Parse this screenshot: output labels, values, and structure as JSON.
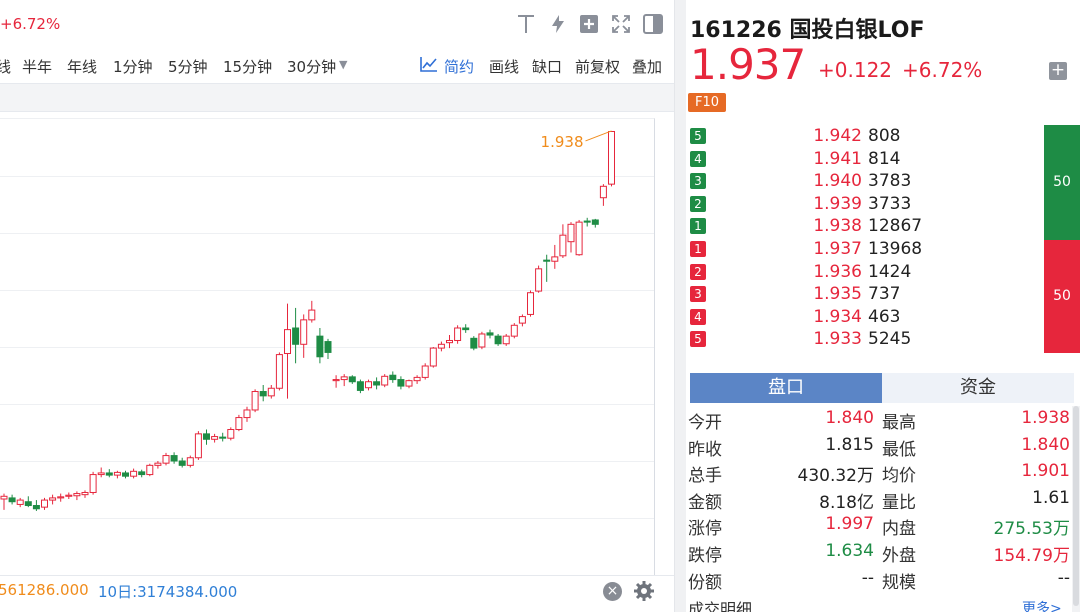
{
  "header_left": {
    "change_pct": "+6.72%"
  },
  "toolbar_icons": [
    "text-tool-icon",
    "lightning-icon",
    "add-box-icon",
    "fullscreen-icon",
    "panel-toggle-icon"
  ],
  "period_tabs": [
    {
      "label": "线"
    },
    {
      "label": "半年"
    },
    {
      "label": "年线"
    },
    {
      "label": "1分钟"
    },
    {
      "label": "5分钟"
    },
    {
      "label": "15分钟"
    },
    {
      "label": "30分钟"
    }
  ],
  "chart_tools": {
    "simple_label": "简约",
    "draw_label": "画线",
    "gap_label": "缺口",
    "adjust_label": "前复权",
    "overlay_label": "叠加"
  },
  "chart_data": {
    "type": "candlestick",
    "annotation": "1.938",
    "colors": {
      "up": "#e6263c",
      "down": "#1e8c45",
      "annotation": "#f08c1c"
    },
    "y_range": [
      1.12,
      1.96
    ],
    "candles": [
      [
        1.26,
        1.27,
        1.24,
        1.265
      ],
      [
        1.262,
        1.268,
        1.25,
        1.255
      ],
      [
        1.25,
        1.262,
        1.245,
        1.258
      ],
      [
        1.255,
        1.265,
        1.245,
        1.248
      ],
      [
        1.248,
        1.258,
        1.238,
        1.242
      ],
      [
        1.245,
        1.262,
        1.24,
        1.258
      ],
      [
        1.258,
        1.268,
        1.25,
        1.262
      ],
      [
        1.262,
        1.27,
        1.255,
        1.264
      ],
      [
        1.265,
        1.272,
        1.26,
        1.267
      ],
      [
        1.266,
        1.274,
        1.258,
        1.27
      ],
      [
        1.268,
        1.276,
        1.262,
        1.272
      ],
      [
        1.272,
        1.31,
        1.268,
        1.305
      ],
      [
        1.305,
        1.318,
        1.3,
        1.308
      ],
      [
        1.308,
        1.315,
        1.3,
        1.304
      ],
      [
        1.304,
        1.312,
        1.298,
        1.309
      ],
      [
        1.308,
        1.312,
        1.298,
        1.302
      ],
      [
        1.302,
        1.316,
        1.298,
        1.311
      ],
      [
        1.31,
        1.314,
        1.3,
        1.305
      ],
      [
        1.305,
        1.325,
        1.302,
        1.322
      ],
      [
        1.322,
        1.33,
        1.316,
        1.326
      ],
      [
        1.326,
        1.345,
        1.322,
        1.34
      ],
      [
        1.34,
        1.346,
        1.325,
        1.33
      ],
      [
        1.33,
        1.336,
        1.318,
        1.322
      ],
      [
        1.322,
        1.34,
        1.318,
        1.336
      ],
      [
        1.336,
        1.385,
        1.332,
        1.38
      ],
      [
        1.38,
        1.388,
        1.36,
        1.37
      ],
      [
        1.37,
        1.38,
        1.364,
        1.375
      ],
      [
        1.374,
        1.382,
        1.366,
        1.372
      ],
      [
        1.372,
        1.392,
        1.368,
        1.388
      ],
      [
        1.388,
        1.415,
        1.385,
        1.41
      ],
      [
        1.41,
        1.43,
        1.402,
        1.424
      ],
      [
        1.424,
        1.462,
        1.42,
        1.458
      ],
      [
        1.458,
        1.47,
        1.44,
        1.45
      ],
      [
        1.45,
        1.47,
        1.445,
        1.464
      ],
      [
        1.464,
        1.53,
        1.46,
        1.526
      ],
      [
        1.528,
        1.62,
        1.445,
        1.572
      ],
      [
        1.575,
        1.612,
        1.51,
        1.545
      ],
      [
        1.545,
        1.6,
        1.52,
        1.59
      ],
      [
        1.59,
        1.625,
        1.585,
        1.608
      ],
      [
        1.56,
        1.575,
        1.51,
        1.522
      ],
      [
        1.55,
        1.555,
        1.518,
        1.53
      ],
      [
        1.478,
        1.488,
        1.465,
        1.48
      ],
      [
        1.48,
        1.49,
        1.468,
        1.485
      ],
      [
        1.485,
        1.488,
        1.472,
        1.476
      ],
      [
        1.476,
        1.48,
        1.455,
        1.46
      ],
      [
        1.465,
        1.48,
        1.46,
        1.476
      ],
      [
        1.476,
        1.484,
        1.462,
        1.47
      ],
      [
        1.47,
        1.49,
        1.466,
        1.486
      ],
      [
        1.488,
        1.495,
        1.474,
        1.48
      ],
      [
        1.48,
        1.486,
        1.462,
        1.468
      ],
      [
        1.468,
        1.48,
        1.464,
        1.478
      ],
      [
        1.478,
        1.488,
        1.472,
        1.484
      ],
      [
        1.484,
        1.51,
        1.48,
        1.505
      ],
      [
        1.505,
        1.54,
        1.502,
        1.538
      ],
      [
        1.538,
        1.55,
        1.532,
        1.545
      ],
      [
        1.548,
        1.562,
        1.538,
        1.552
      ],
      [
        1.552,
        1.58,
        1.546,
        1.575
      ],
      [
        1.575,
        1.582,
        1.566,
        1.572
      ],
      [
        1.556,
        1.56,
        1.534,
        1.538
      ],
      [
        1.54,
        1.568,
        1.536,
        1.564
      ],
      [
        1.566,
        1.572,
        1.556,
        1.562
      ],
      [
        1.56,
        1.564,
        1.542,
        1.546
      ],
      [
        1.546,
        1.564,
        1.542,
        1.56
      ],
      [
        1.56,
        1.584,
        1.556,
        1.58
      ],
      [
        1.584,
        1.6,
        1.578,
        1.596
      ],
      [
        1.6,
        1.644,
        1.596,
        1.64
      ],
      [
        1.643,
        1.69,
        1.64,
        1.684
      ],
      [
        1.7,
        1.71,
        1.66,
        1.698
      ],
      [
        1.698,
        1.728,
        1.684,
        1.706
      ],
      [
        1.708,
        1.766,
        1.704,
        1.746
      ],
      [
        1.734,
        1.77,
        1.714,
        1.766
      ],
      [
        1.71,
        1.774,
        1.708,
        1.77
      ],
      [
        1.772,
        1.778,
        1.762,
        1.77
      ],
      [
        1.774,
        1.776,
        1.76,
        1.766
      ],
      [
        1.815,
        1.84,
        1.8,
        1.836
      ],
      [
        1.84,
        1.938,
        1.836,
        1.937
      ]
    ]
  },
  "bottom_bar": {
    "ma5_volume": "561286.000",
    "ma10_volume": "10日:3174384.000"
  },
  "quote": {
    "code_name": "161226 国投白银LOF",
    "price": "1.937",
    "change": "+0.122",
    "change_pct": "+6.72%",
    "f10_label": "F10"
  },
  "orderbook": {
    "sell": [
      {
        "level": "5",
        "price": "1.942",
        "vol": "808"
      },
      {
        "level": "4",
        "price": "1.941",
        "vol": "814"
      },
      {
        "level": "3",
        "price": "1.940",
        "vol": "3783"
      },
      {
        "level": "2",
        "price": "1.939",
        "vol": "3733"
      },
      {
        "level": "1",
        "price": "1.938",
        "vol": "12867"
      }
    ],
    "buy": [
      {
        "level": "1",
        "price": "1.937",
        "vol": "13968"
      },
      {
        "level": "2",
        "price": "1.936",
        "vol": "1424"
      },
      {
        "level": "3",
        "price": "1.935",
        "vol": "737"
      },
      {
        "level": "4",
        "price": "1.934",
        "vol": "463"
      },
      {
        "level": "5",
        "price": "1.933",
        "vol": "5245"
      }
    ],
    "sell_ratio": "50",
    "buy_ratio": "50"
  },
  "tabs2": {
    "active": "盘口",
    "inactive": "资金"
  },
  "stats": [
    {
      "l1": "今开",
      "v1": "1.840",
      "c1": "red",
      "l2": "最高",
      "v2": "1.938",
      "c2": "red"
    },
    {
      "l1": "昨收",
      "v1": "1.815",
      "c1": "black",
      "l2": "最低",
      "v2": "1.840",
      "c2": "red"
    },
    {
      "l1": "总手",
      "v1": "430.32万",
      "c1": "black",
      "l2": "均价",
      "v2": "1.901",
      "c2": "red"
    },
    {
      "l1": "金额",
      "v1": "8.18亿",
      "c1": "black",
      "l2": "量比",
      "v2": "1.61",
      "c2": "black"
    },
    {
      "l1": "涨停",
      "v1": "1.997",
      "c1": "red",
      "l2": "内盘",
      "v2": "275.53万",
      "c2": "green"
    },
    {
      "l1": "跌停",
      "v1": "1.634",
      "c1": "green",
      "l2": "外盘",
      "v2": "154.79万",
      "c2": "red"
    },
    {
      "l1": "份额",
      "v1": "--",
      "c1": "black",
      "l2": "规模",
      "v2": "--",
      "c2": "black"
    }
  ],
  "detail": {
    "title": "成交明细",
    "more": "更多>"
  }
}
